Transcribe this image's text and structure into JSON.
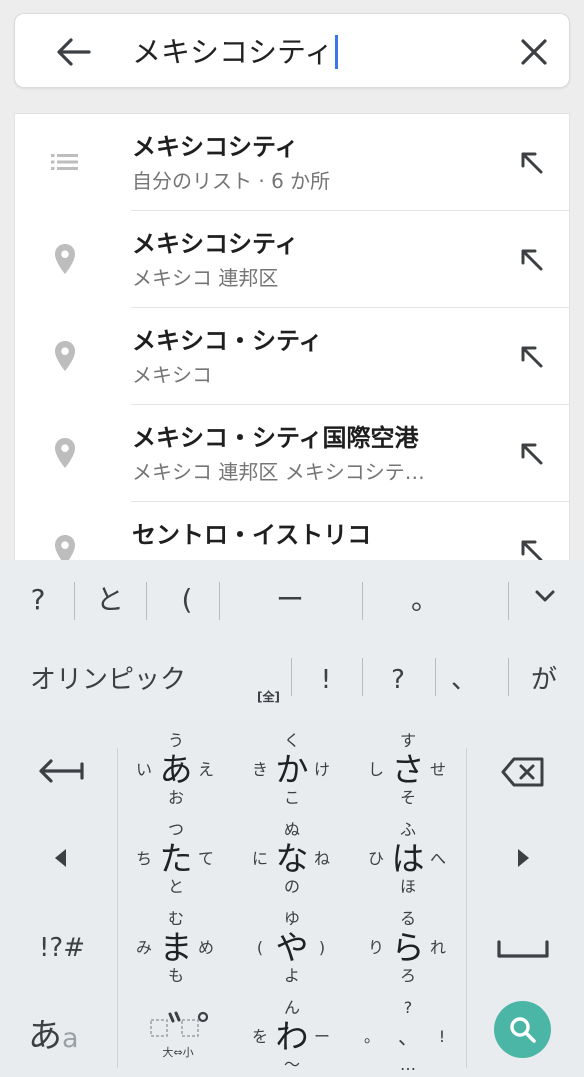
{
  "search": {
    "query": "メキシコシティ"
  },
  "suggestions": [
    {
      "title": "メキシコシティ",
      "subtitle": "自分のリスト · 6 か所",
      "icon": "list-icon"
    },
    {
      "title": "メキシコシティ",
      "subtitle": "メキシコ 連邦区",
      "icon": "place-pin-icon"
    },
    {
      "title": "メキシコ・シティ",
      "subtitle": "メキシコ",
      "icon": "place-pin-icon"
    },
    {
      "title": "メキシコ・シティ国際空港",
      "subtitle": "メキシコ 連邦区 メキシコシテ…",
      "icon": "place-pin-icon"
    },
    {
      "title": "セントロ・イストリコ",
      "subtitle": "",
      "icon": "place-pin-icon"
    }
  ],
  "keyboard": {
    "candidates_row1": [
      "?",
      "と",
      "(",
      "ー",
      "。"
    ],
    "candidates_row2": [
      "オリンピック",
      "!",
      "?",
      "、",
      "が"
    ],
    "zenkaku_label": "[全]",
    "flick_keys": [
      {
        "main": "あ",
        "up": "う",
        "left": "い",
        "right": "え",
        "down": "お"
      },
      {
        "main": "か",
        "up": "く",
        "left": "き",
        "right": "け",
        "down": "こ"
      },
      {
        "main": "さ",
        "up": "す",
        "left": "し",
        "right": "せ",
        "down": "そ"
      },
      {
        "main": "た",
        "up": "つ",
        "left": "ち",
        "right": "て",
        "down": "と"
      },
      {
        "main": "な",
        "up": "ぬ",
        "left": "に",
        "right": "ね",
        "down": "の"
      },
      {
        "main": "は",
        "up": "ふ",
        "left": "ひ",
        "right": "へ",
        "down": "ほ"
      },
      {
        "main": "ま",
        "up": "む",
        "left": "み",
        "right": "め",
        "down": "も"
      },
      {
        "main": "や",
        "up": "ゆ",
        "left": "(",
        "right": ")",
        "down": "よ"
      },
      {
        "main": "ら",
        "up": "る",
        "left": "り",
        "right": "れ",
        "down": "ろ"
      },
      {
        "main": "わ",
        "up": "ん",
        "left": "を",
        "right": "ー",
        "down": "〜"
      }
    ],
    "symbols_label": "!?#",
    "mode_label_main": "あ",
    "mode_label_sub": "a",
    "modifier_label": "大⇔小",
    "punct_up": "?",
    "punct_left": "。",
    "punct_main": "、",
    "punct_right": "!",
    "punct_down": "…"
  }
}
